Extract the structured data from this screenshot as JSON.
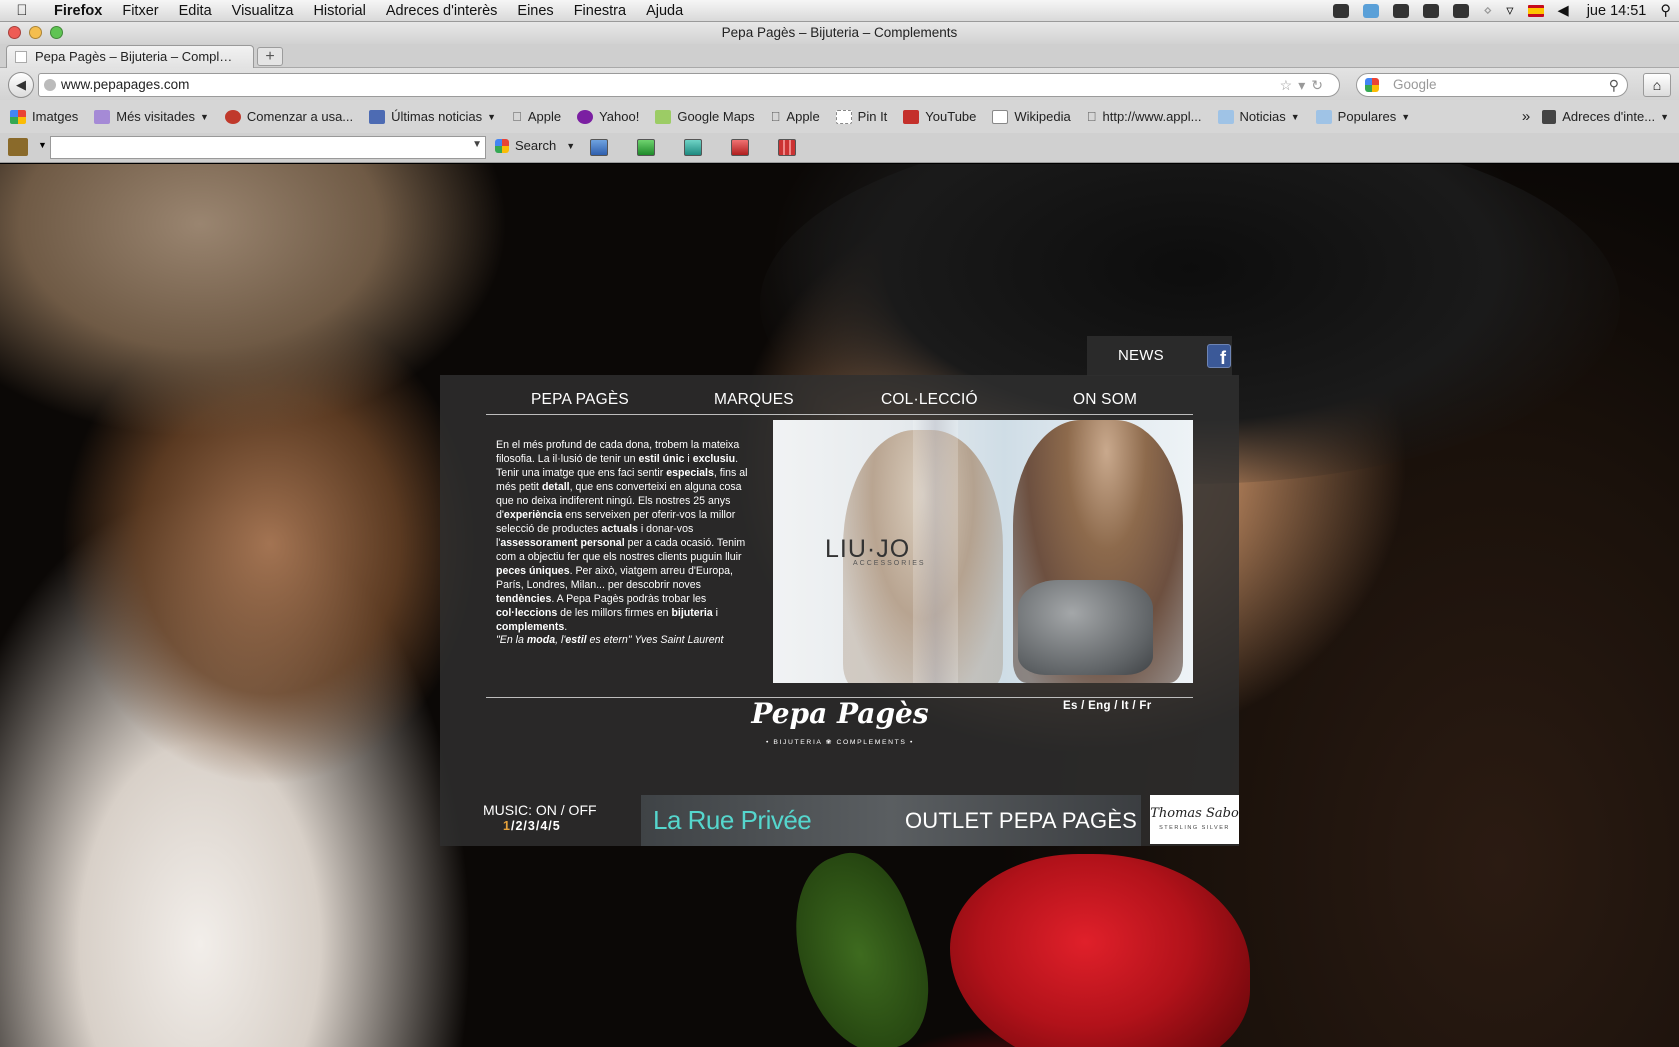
{
  "menubar": {
    "app": "Firefox",
    "items": [
      "Fitxer",
      "Edita",
      "Visualitza",
      "Historial",
      "Adreces d'interès",
      "Eines",
      "Finestra",
      "Ajuda"
    ],
    "time": "jue 14:51"
  },
  "window": {
    "title": "Pepa Pagès – Bijuteria – Complements",
    "tab_title": "Pepa Pagès – Bijuteria – Compl…",
    "new_tab": "+"
  },
  "navbar": {
    "url": "www.pepapages.com",
    "search_placeholder": "Google"
  },
  "bookmarks": {
    "items": [
      {
        "label": "Imatges",
        "menu": false
      },
      {
        "label": "Més visitades",
        "menu": true
      },
      {
        "label": "Comenzar a usa...",
        "menu": false
      },
      {
        "label": "Últimas noticias",
        "menu": true
      },
      {
        "label": "Apple",
        "menu": false
      },
      {
        "label": "Yahoo!",
        "menu": false
      },
      {
        "label": "Google Maps",
        "menu": false
      },
      {
        "label": "Apple",
        "menu": false
      },
      {
        "label": "Pin It",
        "menu": false
      },
      {
        "label": "YouTube",
        "menu": false
      },
      {
        "label": "Wikipedia",
        "menu": false
      },
      {
        "label": "http://www.appl...",
        "menu": false
      },
      {
        "label": "Noticias",
        "menu": true
      },
      {
        "label": "Populares",
        "menu": true
      }
    ],
    "overflow": "»",
    "right_label": "Adreces d'inte..."
  },
  "addonbar": {
    "search_label": "Search"
  },
  "site": {
    "news": "NEWS",
    "facebook": "f",
    "nav": [
      "PEPA PAGÈS",
      "MARQUES",
      "COL·LECCIÓ",
      "ON SOM"
    ],
    "intro": [
      {
        "t": "En el més profund de cada dona, trobem la mateixa filosofia. La il·lusió de tenir un ",
        "b": false
      },
      {
        "t": "estil únic",
        "b": true
      },
      {
        "t": " i ",
        "b": false
      },
      {
        "t": "exclusiu",
        "b": true
      },
      {
        "t": ". Tenir una imatge que ens faci sentir ",
        "b": false
      },
      {
        "t": "especials",
        "b": true
      },
      {
        "t": ", fins al més petit ",
        "b": false
      },
      {
        "t": "detall",
        "b": true
      },
      {
        "t": ", que ens converteixi en alguna cosa que no deixa indiferent ningú. Els nostres 25 anys d'",
        "b": false
      },
      {
        "t": "experiència",
        "b": true
      },
      {
        "t": " ens serveixen per oferir-vos la millor selecció de productes ",
        "b": false
      },
      {
        "t": "actuals",
        "b": true
      },
      {
        "t": " i donar-vos l'",
        "b": false
      },
      {
        "t": "assessorament personal",
        "b": true
      },
      {
        "t": " per a cada ocasió. Tenim com a objectiu fer que els nostres clients puguin lluir ",
        "b": false
      },
      {
        "t": "peces úniques",
        "b": true
      },
      {
        "t": ". Per això, viatgem arreu d'Europa, París, Londres, Milan... per descobrir noves ",
        "b": false
      },
      {
        "t": "tendències",
        "b": true
      },
      {
        "t": ". A Pepa Pagès podràs trobar les ",
        "b": false
      },
      {
        "t": "col·leccions",
        "b": true
      },
      {
        "t": " de les millors firmes en ",
        "b": false
      },
      {
        "t": "bijuteria",
        "b": true
      },
      {
        "t": " i ",
        "b": false
      },
      {
        "t": "complements",
        "b": true
      },
      {
        "t": ".",
        "b": false
      }
    ],
    "quote": [
      {
        "t": "\"En la ",
        "b": false
      },
      {
        "t": "moda",
        "b": true
      },
      {
        "t": ", l'",
        "b": false
      },
      {
        "t": "estil",
        "b": true
      },
      {
        "t": " es etern\" Yves Saint Laurent",
        "b": false
      }
    ],
    "photo_brand": "LIU·JO",
    "photo_brand_sub": "ACCESSORIES",
    "languages": "Es / Eng / It / Fr",
    "logo": "Pepa Pagès",
    "logo_sub": "• BIJUTERIA ❀ COMPLEMENTS •",
    "music_label": "MUSIC: ON / OFF",
    "tracks": [
      "1",
      "2",
      "3",
      "4",
      "5"
    ],
    "active_track": "1",
    "rue": "La Rue Privée",
    "outlet": "OUTLET PEPA PAGÈS",
    "thomas": "Thomas Sabo",
    "thomas_sub": "STERLING SILVER"
  }
}
